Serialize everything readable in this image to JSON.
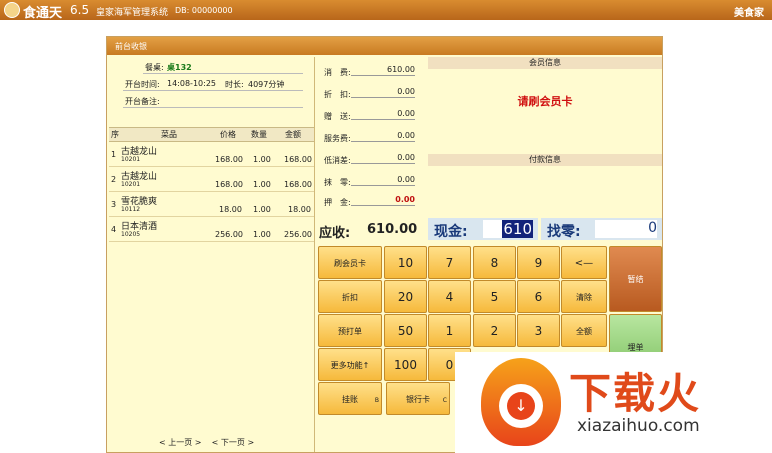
{
  "app": {
    "name": "食通天",
    "version": "6.5",
    "system_title": "皇家海军管理系统",
    "db": "DB: 00000000",
    "brand": "美食家"
  },
  "panel": {
    "title": "前台收银"
  },
  "order": {
    "table_label": "餐桌:",
    "table_value": "桌132",
    "open_time_label": "开台时间:",
    "open_time_value": "14:08-10:25",
    "duration_label": "时长:",
    "duration_value": "4097分钟",
    "remark_label": "开台备注:"
  },
  "table": {
    "headers": {
      "seq": "序",
      "name": "菜品",
      "price": "价格",
      "qty": "数量",
      "amount": "金额"
    },
    "rows": [
      {
        "seq": "1",
        "name": "古越龙山",
        "code": "10201",
        "price": "168.00",
        "qty": "1.00",
        "amount": "168.00"
      },
      {
        "seq": "2",
        "name": "古越龙山",
        "code": "10201",
        "price": "168.00",
        "qty": "1.00",
        "amount": "168.00"
      },
      {
        "seq": "3",
        "name": "雪花脆爽",
        "code": "10112",
        "price": "18.00",
        "qty": "1.00",
        "amount": "18.00"
      },
      {
        "seq": "4",
        "name": "日本清酒",
        "code": "10205",
        "price": "256.00",
        "qty": "1.00",
        "amount": "256.00"
      }
    ]
  },
  "pager": {
    "prev": "< 上一页 >",
    "next": "< 下一页 >"
  },
  "fees": [
    {
      "label": "消　费:",
      "value": "610.00"
    },
    {
      "label": "折　扣:",
      "value": "0.00"
    },
    {
      "label": "赠　送:",
      "value": "0.00"
    },
    {
      "label": "服务费:",
      "value": "0.00"
    },
    {
      "label": "低消差:",
      "value": "0.00"
    },
    {
      "label": "抹　零:",
      "value": "0.00"
    },
    {
      "label": "押　金:",
      "value": "0.00"
    }
  ],
  "member": {
    "header": "会员信息",
    "prompt": "请刷会员卡",
    "payment_header": "付款信息"
  },
  "payment": {
    "receivable_label": "应收:",
    "receivable_value": "610.00",
    "cash_label": "现金:",
    "cash_value": "610",
    "change_label": "找零:",
    "change_value": "0"
  },
  "keypad": {
    "member_card": "刷会员卡",
    "discount": "折扣",
    "pre_print": "预打单",
    "more": "更多功能↑",
    "n10": "10",
    "n20": "20",
    "n50": "50",
    "n100": "100",
    "k7": "7",
    "k8": "8",
    "k9": "9",
    "back": "<—",
    "k4": "4",
    "k5": "5",
    "k6": "6",
    "clear": "清除",
    "k1": "1",
    "k2": "2",
    "k3": "3",
    "full": "全额",
    "k0": "0",
    "hold": "暂结",
    "checkout": "埋单",
    "credit": "挂账",
    "credit_key": "B",
    "bank_card": "银行卡",
    "bank_key": "C"
  },
  "watermark": {
    "title": "下载火",
    "url": "xiazaihuo.com"
  }
}
